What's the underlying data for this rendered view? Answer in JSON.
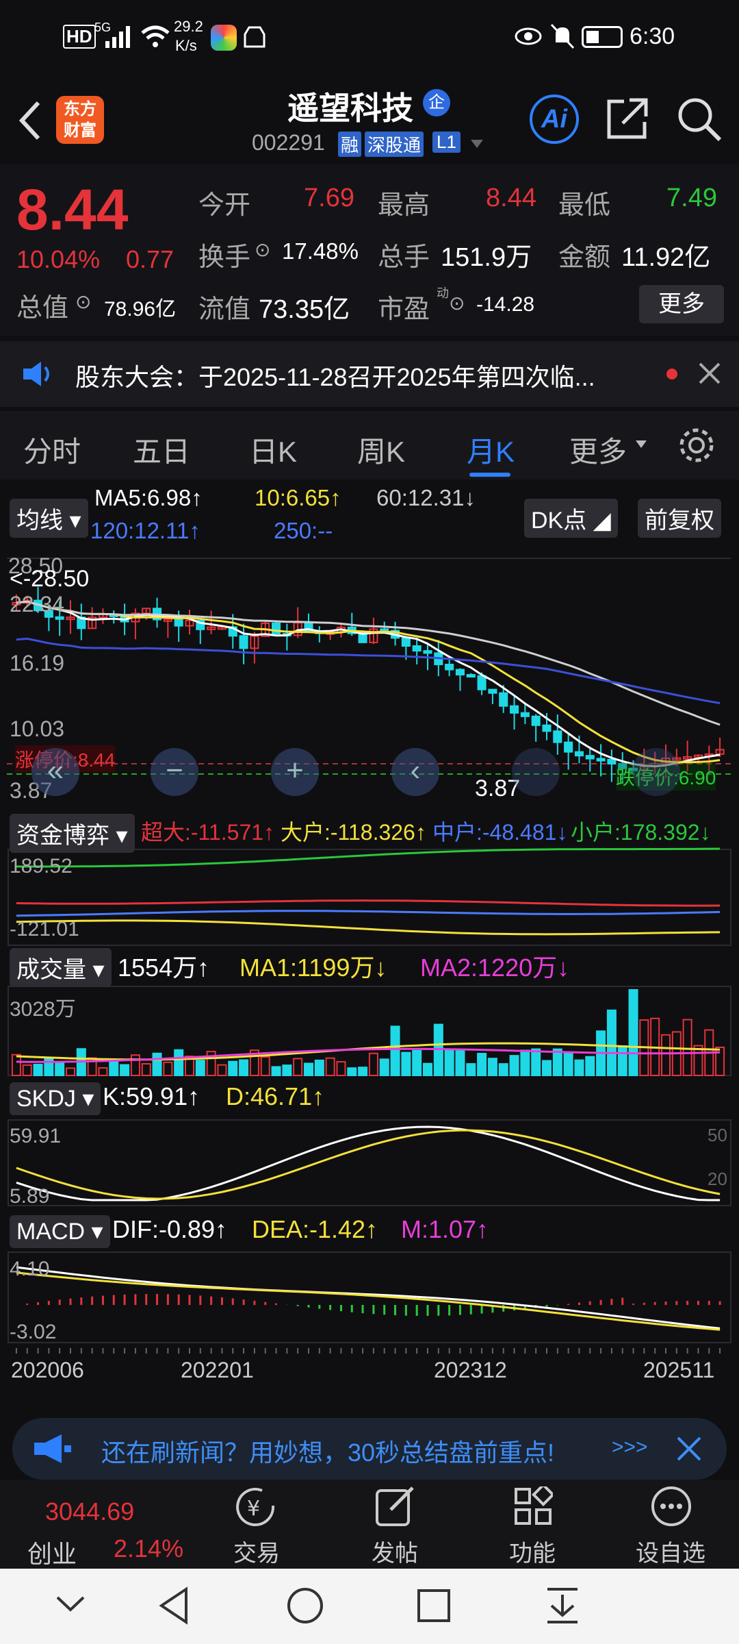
{
  "status": {
    "hd": "HD",
    "net": "5G",
    "speed_top": "29.2",
    "speed_bottom": "K/s",
    "time": "6:30"
  },
  "header": {
    "logo_line1": "东方",
    "logo_line2": "财富",
    "title": "遥望科技",
    "corp_badge": "企",
    "code": "002291",
    "badge_margin": "融",
    "badge_connect": "深股通",
    "badge_level": "L1",
    "ai": "Ai"
  },
  "quote": {
    "price": "8.44",
    "pct": "10.04%",
    "chg": "0.77",
    "open_label": "今开",
    "open": "7.69",
    "high_label": "最高",
    "high": "8.44",
    "low_label": "最低",
    "low": "7.49",
    "turnover_label": "换手",
    "turnover": "17.48%",
    "vol_label": "总手",
    "vol": "151.9万",
    "amount_label": "金额",
    "amount": "11.92亿",
    "mktcap_label": "总值",
    "mktcap": "78.96亿",
    "float_label": "流值",
    "float": "73.35亿",
    "pe_label": "市盈",
    "pe_sup": "动",
    "pe": "-14.28",
    "more": "更多"
  },
  "notice": {
    "text": "股东大会：于2025-11-28召开2025年第四次临..."
  },
  "tabs": [
    "分时",
    "五日",
    "日K",
    "周K",
    "月K",
    "更多"
  ],
  "active_tab": "月K",
  "kline": {
    "tag": "均线",
    "ma5": "MA5:6.98↑",
    "ma10": "10:6.65↑",
    "ma60": "60:12.31↓",
    "ma120": "120:12.11↑",
    "ma250": "250:--",
    "dk": "DK点",
    "adj": "前复权",
    "y_top": "28.50",
    "y_2": "22.34",
    "y_3": "16.19",
    "y_4": "10.03",
    "y_bottom": "3.87",
    "max_marker": "<-28.50",
    "min_marker": "3.87",
    "limit_up": "涨停价:8.44",
    "limit_down": "跌停价:6.90"
  },
  "fund": {
    "tag": "资金博弈",
    "super": "超大:-11.571↑",
    "large": "大户:-118.326↑",
    "mid": "中户:-48.481↓",
    "small": "小户:178.392↓",
    "y_top": "189.52",
    "y_bottom": "-121.01"
  },
  "volume": {
    "tag": "成交量",
    "vol": "1554万↑",
    "ma1": "MA1:1199万↓",
    "ma2": "MA2:1220万↓",
    "y_top": "3028万"
  },
  "skdj": {
    "tag": "SKDJ",
    "k": "K:59.91↑",
    "d": "D:46.71↑",
    "y_top": "59.91",
    "y_bottom": "5.89",
    "r80": "50",
    "r20": "20"
  },
  "macd": {
    "tag": "MACD",
    "dif": "DIF:-0.89↑",
    "dea": "DEA:-1.42↑",
    "m": "M:1.07↑",
    "y_top": "4.10",
    "y_bottom": "-3.02"
  },
  "xaxis": [
    "202006",
    "202201",
    "202312",
    "202511"
  ],
  "ad": {
    "text": "还在刷新闻？用妙想，30秒总结盘前重点!",
    "arrows": ">>>"
  },
  "bottom": {
    "index_value": "3044.69",
    "index_name": "创业",
    "index_pct": "2.14%",
    "trade": "交易",
    "post": "发帖",
    "func": "功能",
    "watch": "设自选"
  },
  "colors": {
    "up": "#e5333a",
    "down": "#2bc83a",
    "ma5": "#ffffff",
    "ma10": "#f4e13a",
    "ma60": "#cfcfcf",
    "ma120": "#3b50d8",
    "accent": "#2f80ff"
  }
}
